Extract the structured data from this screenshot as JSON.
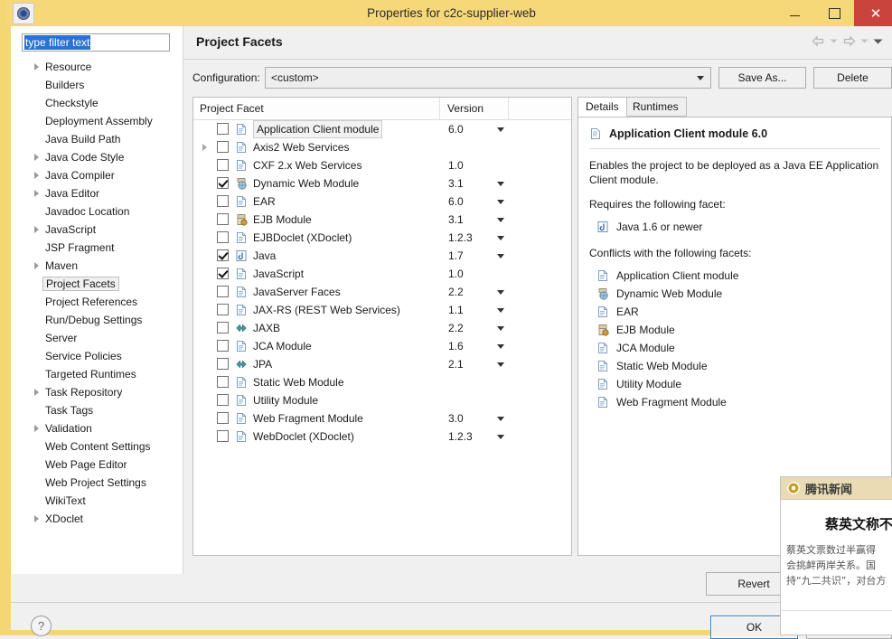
{
  "window": {
    "title": "Properties for c2c-supplier-web",
    "icon": "eclipse-properties-icon",
    "minimize_label": "",
    "maximize_label": "",
    "close_label": "✕"
  },
  "sidebar": {
    "filter": {
      "value": "type filter text",
      "placeholder": "type filter text"
    },
    "items": [
      {
        "label": "Resource",
        "expandable": true,
        "selected": false
      },
      {
        "label": "Builders",
        "expandable": false,
        "selected": false
      },
      {
        "label": "Checkstyle",
        "expandable": false,
        "selected": false
      },
      {
        "label": "Deployment Assembly",
        "expandable": false,
        "selected": false
      },
      {
        "label": "Java Build Path",
        "expandable": false,
        "selected": false
      },
      {
        "label": "Java Code Style",
        "expandable": true,
        "selected": false
      },
      {
        "label": "Java Compiler",
        "expandable": true,
        "selected": false
      },
      {
        "label": "Java Editor",
        "expandable": true,
        "selected": false
      },
      {
        "label": "Javadoc Location",
        "expandable": false,
        "selected": false
      },
      {
        "label": "JavaScript",
        "expandable": true,
        "selected": false
      },
      {
        "label": "JSP Fragment",
        "expandable": false,
        "selected": false
      },
      {
        "label": "Maven",
        "expandable": true,
        "selected": false
      },
      {
        "label": "Project Facets",
        "expandable": false,
        "selected": true
      },
      {
        "label": "Project References",
        "expandable": false,
        "selected": false
      },
      {
        "label": "Run/Debug Settings",
        "expandable": false,
        "selected": false
      },
      {
        "label": "Server",
        "expandable": false,
        "selected": false
      },
      {
        "label": "Service Policies",
        "expandable": false,
        "selected": false
      },
      {
        "label": "Targeted Runtimes",
        "expandable": false,
        "selected": false
      },
      {
        "label": "Task Repository",
        "expandable": true,
        "selected": false
      },
      {
        "label": "Task Tags",
        "expandable": false,
        "selected": false
      },
      {
        "label": "Validation",
        "expandable": true,
        "selected": false
      },
      {
        "label": "Web Content Settings",
        "expandable": false,
        "selected": false
      },
      {
        "label": "Web Page Editor",
        "expandable": false,
        "selected": false
      },
      {
        "label": "Web Project Settings",
        "expandable": false,
        "selected": false
      },
      {
        "label": "WikiText",
        "expandable": false,
        "selected": false
      },
      {
        "label": "XDoclet",
        "expandable": true,
        "selected": false
      }
    ]
  },
  "pane": {
    "title": "Project Facets",
    "nav_back_icon": "back-arrow-icon",
    "nav_forward_icon": "forward-arrow-icon",
    "nav_menu_icon": "chevron-down-icon"
  },
  "configuration": {
    "label": "Configuration:",
    "value": "<custom>",
    "save_as_label": "Save As...",
    "delete_label": "Delete"
  },
  "facet_table": {
    "columns": [
      "Project Facet",
      "Version"
    ],
    "rows": [
      {
        "name": "Application Client module",
        "version": "6.0",
        "checked": false,
        "expandable": false,
        "icon": "document-icon",
        "has_version_menu": true,
        "highlighted": true
      },
      {
        "name": "Axis2 Web Services",
        "version": "",
        "checked": false,
        "expandable": true,
        "icon": "document-icon",
        "has_version_menu": false,
        "highlighted": false
      },
      {
        "name": "CXF 2.x Web Services",
        "version": "1.0",
        "checked": false,
        "expandable": false,
        "icon": "document-icon",
        "has_version_menu": false,
        "highlighted": false
      },
      {
        "name": "Dynamic Web Module",
        "version": "3.1",
        "checked": true,
        "expandable": false,
        "icon": "web-module-icon",
        "has_version_menu": true,
        "highlighted": false
      },
      {
        "name": "EAR",
        "version": "6.0",
        "checked": false,
        "expandable": false,
        "icon": "document-icon",
        "has_version_menu": true,
        "highlighted": false
      },
      {
        "name": "EJB Module",
        "version": "3.1",
        "checked": false,
        "expandable": false,
        "icon": "ejb-module-icon",
        "has_version_menu": true,
        "highlighted": false
      },
      {
        "name": "EJBDoclet (XDoclet)",
        "version": "1.2.3",
        "checked": false,
        "expandable": false,
        "icon": "document-icon",
        "has_version_menu": true,
        "highlighted": false
      },
      {
        "name": "Java",
        "version": "1.7",
        "checked": true,
        "expandable": false,
        "icon": "java-icon",
        "has_version_menu": true,
        "highlighted": false
      },
      {
        "name": "JavaScript",
        "version": "1.0",
        "checked": true,
        "expandable": false,
        "icon": "document-icon",
        "has_version_menu": false,
        "highlighted": false
      },
      {
        "name": "JavaServer Faces",
        "version": "2.2",
        "checked": false,
        "expandable": false,
        "icon": "document-icon",
        "has_version_menu": true,
        "highlighted": false
      },
      {
        "name": "JAX-RS (REST Web Services)",
        "version": "1.1",
        "checked": false,
        "expandable": false,
        "icon": "document-icon",
        "has_version_menu": true,
        "highlighted": false
      },
      {
        "name": "JAXB",
        "version": "2.2",
        "checked": false,
        "expandable": false,
        "icon": "binding-arrows-icon",
        "has_version_menu": true,
        "highlighted": false
      },
      {
        "name": "JCA Module",
        "version": "1.6",
        "checked": false,
        "expandable": false,
        "icon": "document-icon",
        "has_version_menu": true,
        "highlighted": false
      },
      {
        "name": "JPA",
        "version": "2.1",
        "checked": false,
        "expandable": false,
        "icon": "binding-arrows-icon",
        "has_version_menu": true,
        "highlighted": false
      },
      {
        "name": "Static Web Module",
        "version": "",
        "checked": false,
        "expandable": false,
        "icon": "document-icon",
        "has_version_menu": false,
        "highlighted": false
      },
      {
        "name": "Utility Module",
        "version": "",
        "checked": false,
        "expandable": false,
        "icon": "document-icon",
        "has_version_menu": false,
        "highlighted": false
      },
      {
        "name": "Web Fragment Module",
        "version": "3.0",
        "checked": false,
        "expandable": false,
        "icon": "document-icon",
        "has_version_menu": true,
        "highlighted": false
      },
      {
        "name": "WebDoclet (XDoclet)",
        "version": "1.2.3",
        "checked": false,
        "expandable": false,
        "icon": "document-icon",
        "has_version_menu": true,
        "highlighted": false
      }
    ]
  },
  "details": {
    "tabs": [
      {
        "label": "Details",
        "active": true
      },
      {
        "label": "Runtimes",
        "active": false
      }
    ],
    "title": "Application Client module 6.0",
    "title_icon": "document-icon",
    "description": "Enables the project to be deployed as a Java EE Application Client module.",
    "requires_label": "Requires the following facet:",
    "requires": [
      {
        "label": "Java 1.6 or newer",
        "icon": "java-icon"
      }
    ],
    "conflicts_label": "Conflicts with the following facets:",
    "conflicts": [
      {
        "label": "Application Client module",
        "icon": "document-icon"
      },
      {
        "label": "Dynamic Web Module",
        "icon": "web-module-icon"
      },
      {
        "label": "EAR",
        "icon": "document-icon"
      },
      {
        "label": "EJB Module",
        "icon": "ejb-module-icon"
      },
      {
        "label": "JCA Module",
        "icon": "document-icon"
      },
      {
        "label": "Static Web Module",
        "icon": "document-icon"
      },
      {
        "label": "Utility Module",
        "icon": "document-icon"
      },
      {
        "label": "Web Fragment Module",
        "icon": "document-icon"
      }
    ]
  },
  "footer": {
    "revert_label": "Revert",
    "apply_label": "",
    "help_icon": "question-mark-icon",
    "ok_label": "OK",
    "cancel_label": ""
  },
  "news_popup": {
    "brand": "腾讯新闻",
    "logo_icon": "tencent-news-logo-icon",
    "headline": "蔡英文称不",
    "body_lines": [
      "蔡英文票数过半赢得",
      "会挑衅两岸关系。国",
      "持“九二共识”，对台方"
    ]
  },
  "colors": {
    "frame": "#f4d675",
    "titlebar": "#f6d878",
    "close": "#c9443c",
    "selection": "#2a72d4",
    "ok_border": "#3c7fb1"
  }
}
